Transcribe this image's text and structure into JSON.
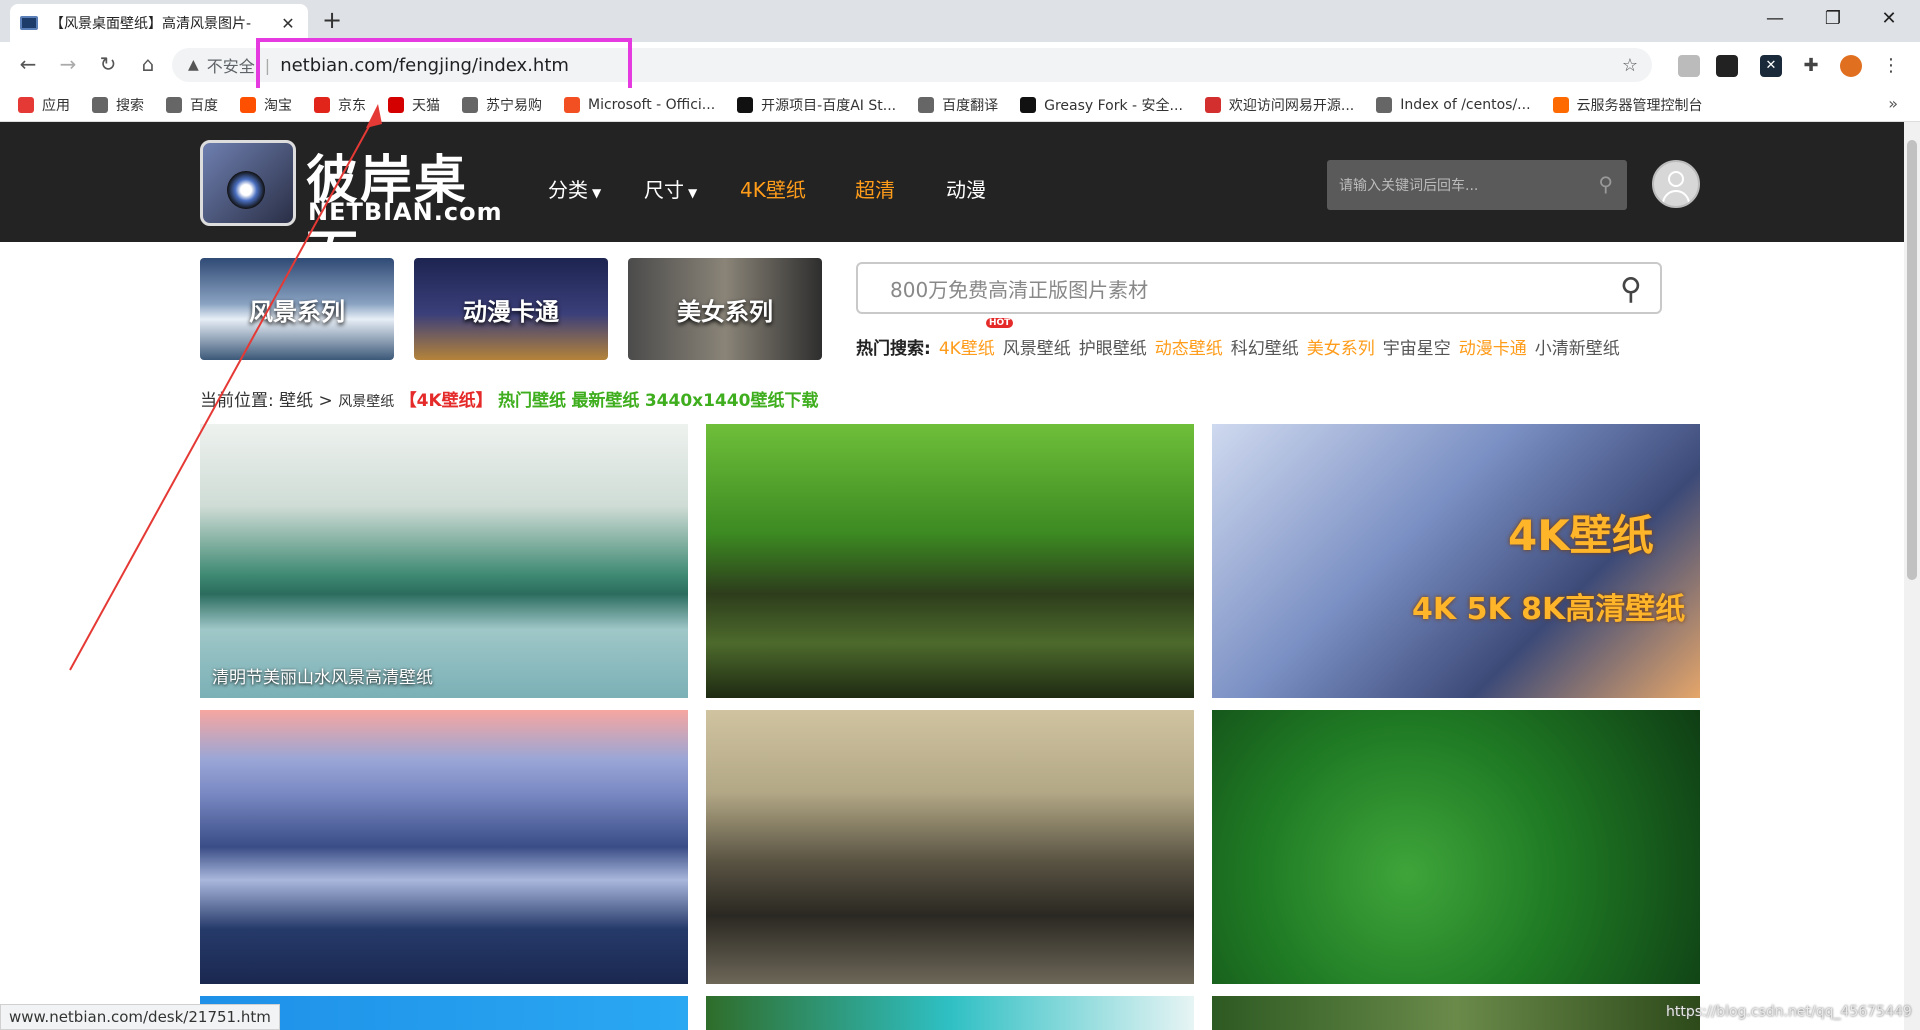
{
  "tab": {
    "title": "【风景桌面壁纸】高清风景图片-",
    "close": "✕",
    "new": "+"
  },
  "window": {
    "minimize": "—",
    "maximize": "❐",
    "close": "✕"
  },
  "toolbar": {
    "back": "←",
    "forward": "→",
    "reload": "↻",
    "home": "⌂",
    "warn_icon": "▲",
    "insecure": "不安全",
    "url": "netbian.com/fengjing/index.htm",
    "star": "☆"
  },
  "bookmarks": [
    {
      "label": "应用",
      "icon": "apps-icon",
      "color": "#e53935"
    },
    {
      "label": "搜索",
      "icon": "globe-icon",
      "color": "#666666"
    },
    {
      "label": "百度",
      "icon": "globe-icon",
      "color": "#666666"
    },
    {
      "label": "淘宝",
      "icon": "taobao-icon",
      "color": "#ff5000"
    },
    {
      "label": "京东",
      "icon": "jd-icon",
      "color": "#e1251b"
    },
    {
      "label": "天猫",
      "icon": "tmall-icon",
      "color": "#d40000"
    },
    {
      "label": "苏宁易购",
      "icon": "globe-icon",
      "color": "#666666"
    },
    {
      "label": "Microsoft - Offici...",
      "icon": "microsoft-icon",
      "color": "#f25022"
    },
    {
      "label": "开源项目-百度AI St...",
      "icon": "ai-icon",
      "color": "#111111"
    },
    {
      "label": "百度翻译",
      "icon": "globe-icon",
      "color": "#666666"
    },
    {
      "label": "Greasy Fork - 安全...",
      "icon": "greasyfork-icon",
      "color": "#111111"
    },
    {
      "label": "欢迎访问网易开源...",
      "icon": "netease-icon",
      "color": "#d32f2f"
    },
    {
      "label": "Index of /centos/...",
      "icon": "globe-icon",
      "color": "#666666"
    },
    {
      "label": "云服务器管理控制台",
      "icon": "aliyun-icon",
      "color": "#ff6a00"
    }
  ],
  "bookmarks_more": "»",
  "site": {
    "logo_cn": "彼岸桌面",
    "logo_en": "NETBIAN.com",
    "nav": {
      "category": "分类",
      "size": "尺寸",
      "k4": "4K壁纸",
      "hd": "超清",
      "anime": "动漫"
    },
    "search_placeholder": "请输入关键词后回车...",
    "categories": [
      "风景系列",
      "动漫卡通",
      "美女系列"
    ],
    "big_search_placeholder": "800万免费高清正版图片素材",
    "hot": {
      "label": "热门搜索:",
      "badge": "HOT",
      "items": [
        "4K壁纸",
        "风景壁纸",
        "护眼壁纸",
        "动态壁纸",
        "科幻壁纸",
        "美女系列",
        "宇宙星空",
        "动漫卡通",
        "小清新壁纸"
      ]
    },
    "breadcrumb": {
      "prefix": "当前位置:",
      "wallpaper": "壁纸",
      "gt": ">",
      "current": "风景壁纸",
      "k4": "【4K壁纸】",
      "hot": "热门壁纸",
      "latest": "最新壁纸",
      "res": "3440x1440壁纸下载"
    },
    "thumbs": [
      {
        "caption": "清明节美丽山水风景高清壁纸"
      },
      {
        "caption": ""
      },
      {
        "caption": "",
        "overlay1": "4K壁纸",
        "overlay2": "4K 5K 8K高清壁纸"
      },
      {
        "caption": ""
      },
      {
        "caption": ""
      },
      {
        "caption": ""
      }
    ]
  },
  "status_url": "www.netbian.com/desk/21751.htm",
  "watermark": "https://blog.csdn.net/qq_45675449",
  "colors": {
    "accent_orange": "#ff9c1a",
    "highlight_magenta": "#e43ae0",
    "arrow_red": "#e53935",
    "hot_red": "#e52a2a",
    "green": "#3fae1e"
  }
}
